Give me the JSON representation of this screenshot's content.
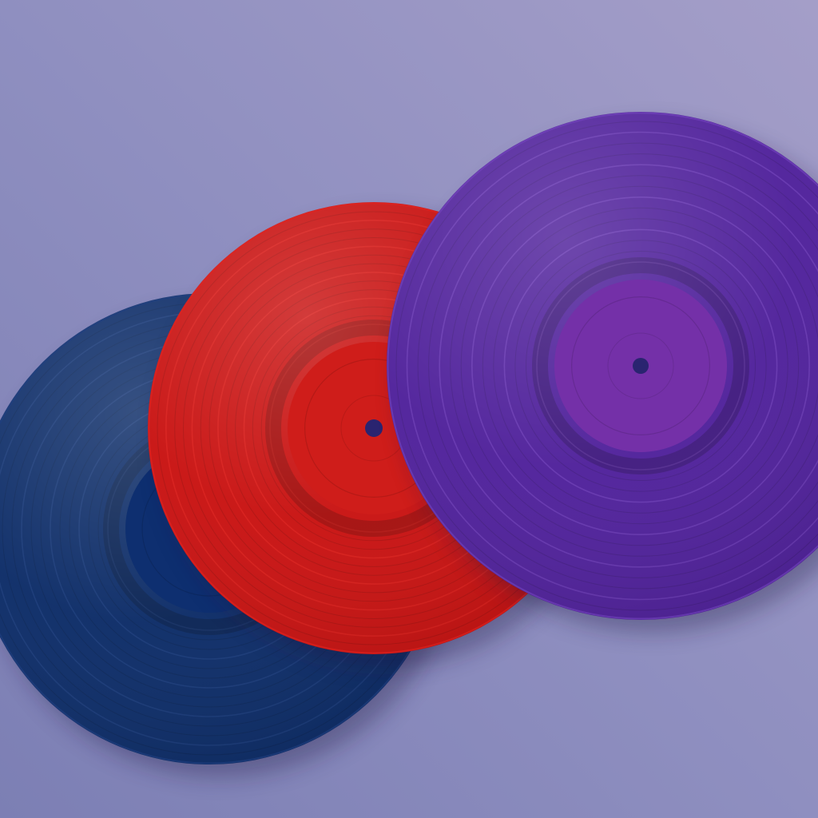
{
  "scene": {
    "background": {
      "colors": [
        "#a49ec8",
        "#8f8fc0",
        "#7c7fb4"
      ],
      "description_text": ""
    },
    "records": [
      {
        "name": "navy-record",
        "color": "#0a2a66",
        "highlight_color": "#1f3f82",
        "label_color": "#0e2f70",
        "label_hole": false
      },
      {
        "name": "red-record",
        "color": "#c8100f",
        "highlight_color": "#e3231f",
        "label_color": "#cf1d1a",
        "label_hole": true
      },
      {
        "name": "purple-record",
        "color": "#4e1f9a",
        "highlight_color": "#7444c0",
        "label_color": "#7430a8",
        "label_hole": true
      }
    ]
  }
}
